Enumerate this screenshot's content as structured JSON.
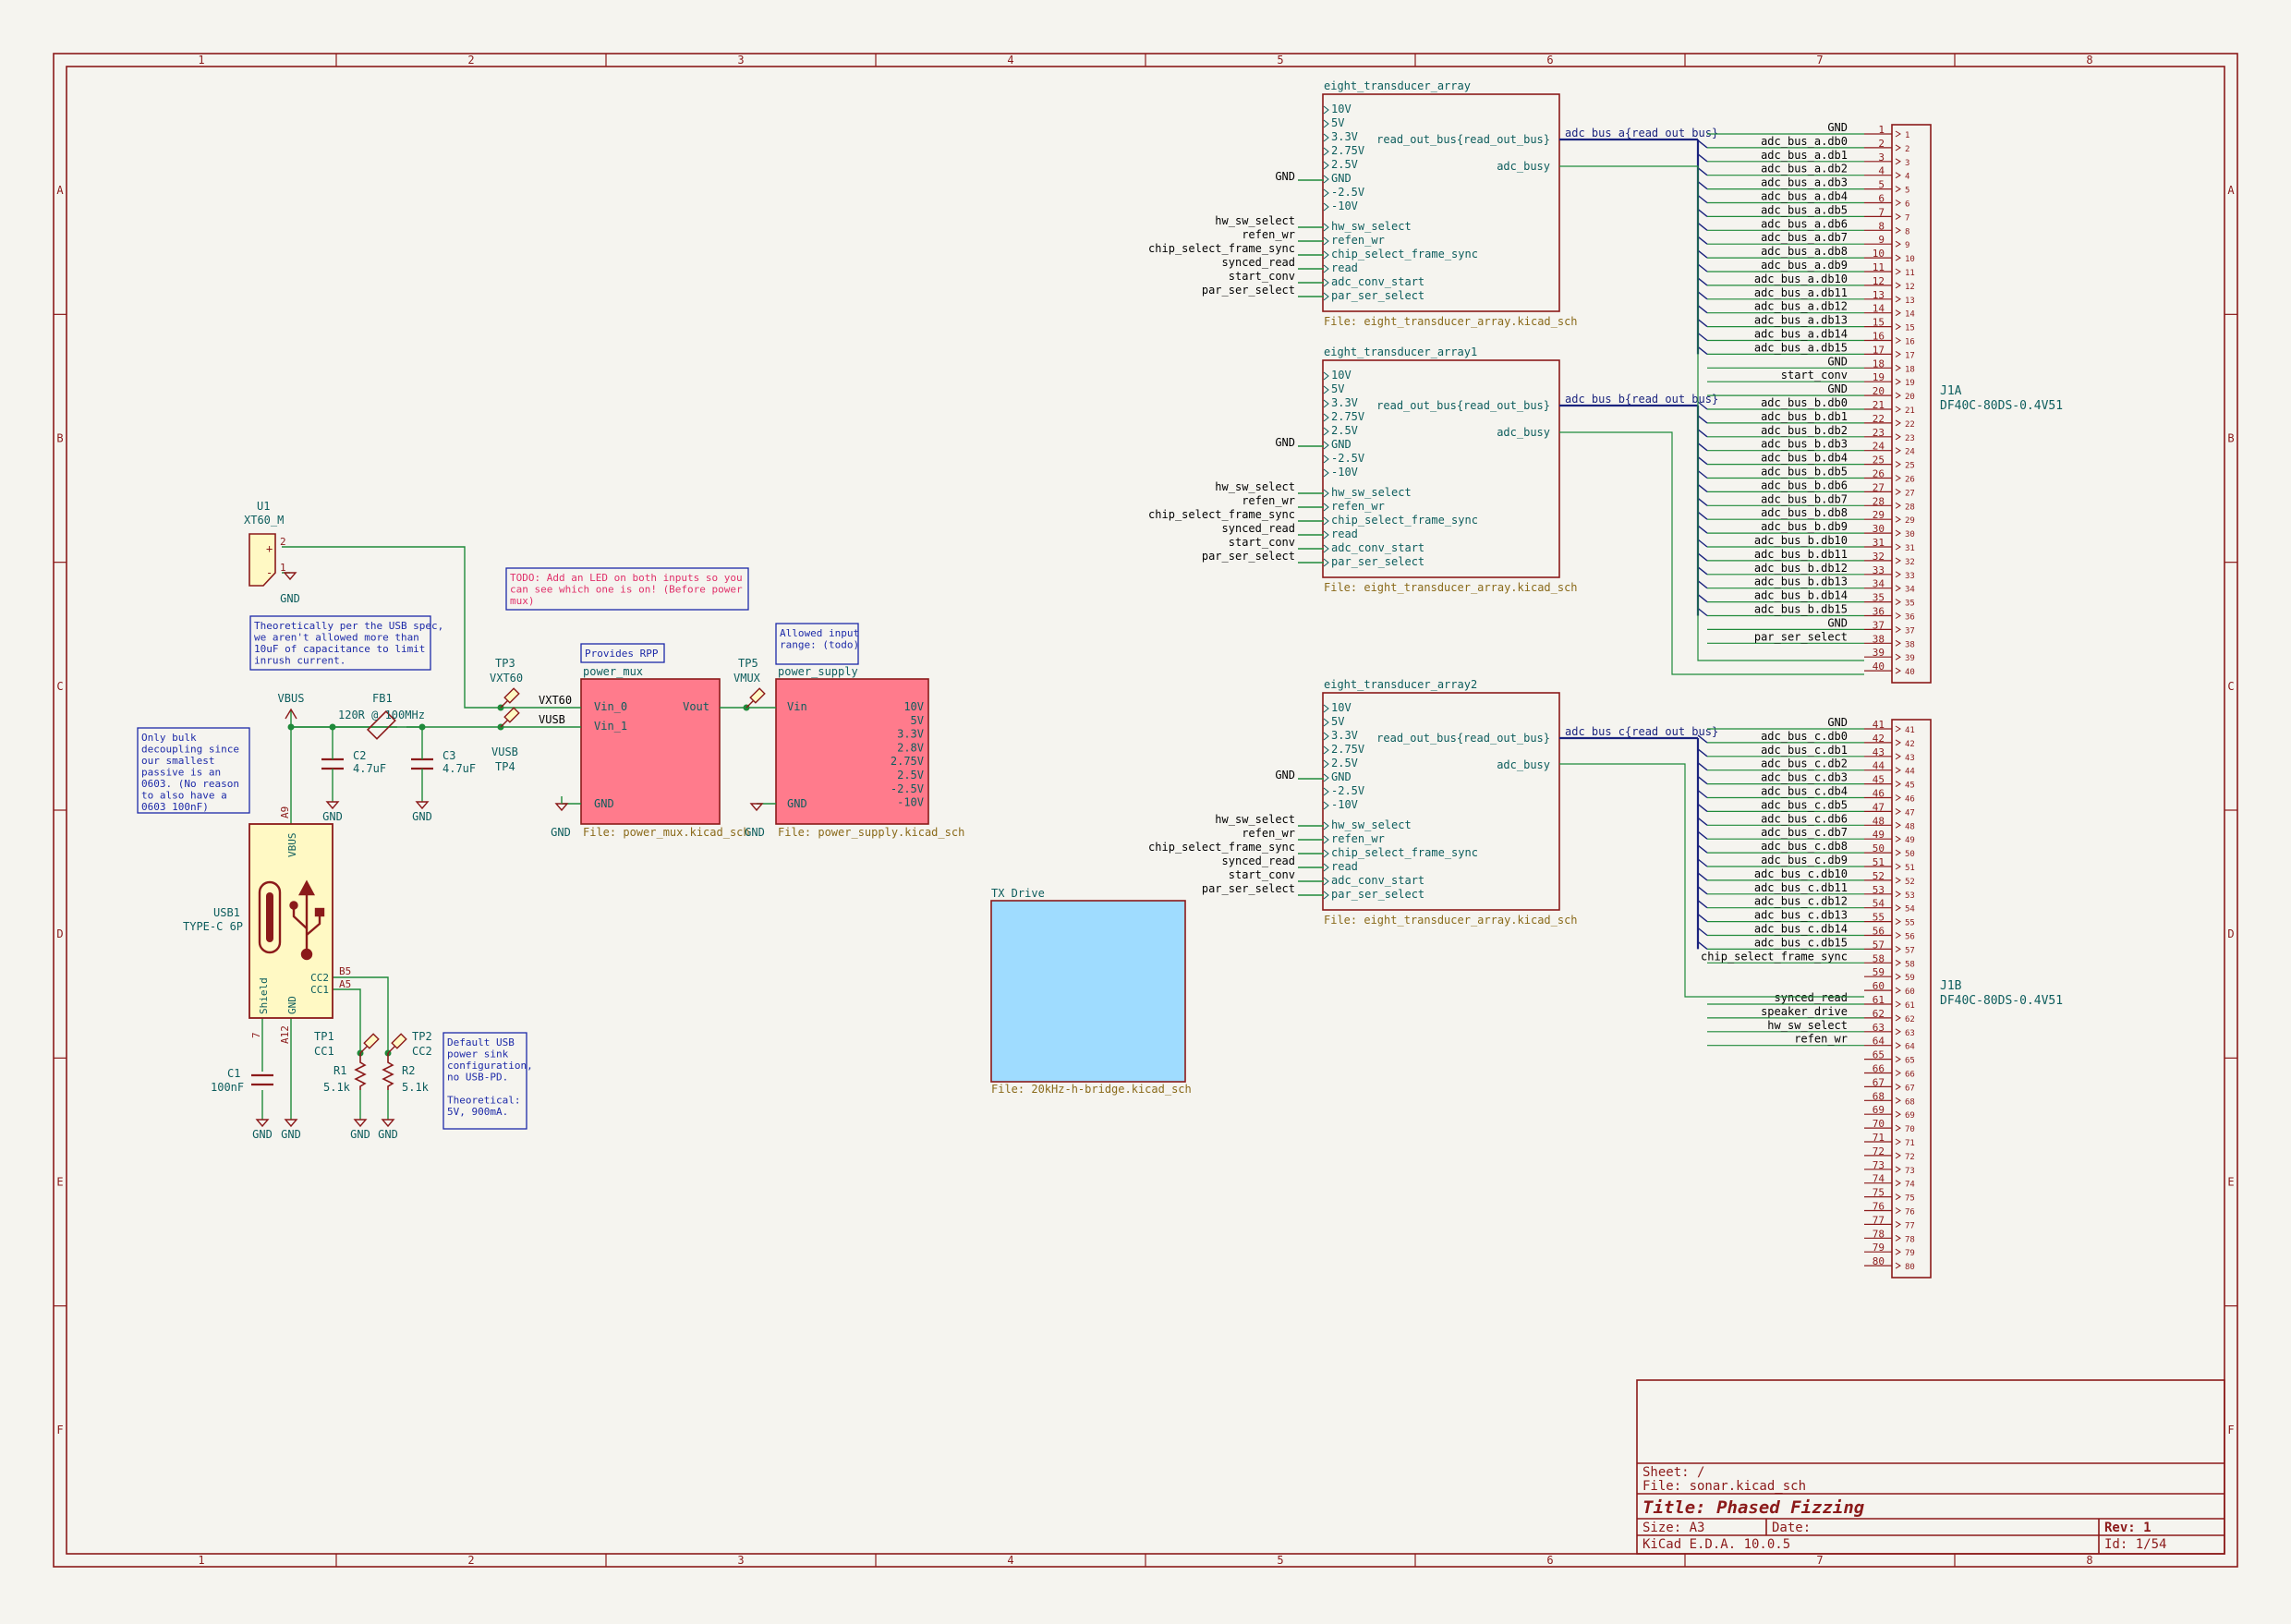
{
  "colors": {
    "frame": "#8b1a1a",
    "wire": "#1f8a3a",
    "bus": "#1a237e",
    "label": "#0d5d5d",
    "ref": "#0d5d5d",
    "note": "#1d2aa8",
    "todo": "#e0306a",
    "sheet_file": "#8a6a1a",
    "pink": "#ff7b8c",
    "blue": "#9fdcff",
    "comp_fill": "#fff9c4"
  },
  "frame": {
    "columns": [
      "1",
      "2",
      "3",
      "4",
      "5",
      "6",
      "7",
      "8"
    ],
    "rows": [
      "A",
      "B",
      "C",
      "D",
      "E",
      "F"
    ]
  },
  "title_block": {
    "sheet": "Sheet: /",
    "file": "File: sonar.kicad_sch",
    "title": "Title: Phased Fizzing",
    "size": "Size: A3",
    "date": "Date:",
    "rev": "Rev: 1",
    "tool": "KiCad E.D.A. 10.0.5",
    "id": "Id: 1/54"
  },
  "hier_labels": {
    "adc": [
      "hw_sw_select",
      "refen_wr",
      "chip_select_frame_sync",
      "synced_read",
      "start_conv",
      "par_ser_select"
    ],
    "gnd": "GND"
  },
  "sheets": {
    "eta": [
      {
        "name": "eight_transducer_array",
        "file": "File: eight_transducer_array.kicad_sch",
        "bus_label": "adc_bus_a{read_out_bus}"
      },
      {
        "name": "eight_transducer_array1",
        "file": "File: eight_transducer_array.kicad_sch",
        "bus_label": "adc_bus_b{read_out_bus}"
      },
      {
        "name": "eight_transducer_array2",
        "file": "File: eight_transducer_array.kicad_sch",
        "bus_label": "adc_bus_c{read_out_bus}"
      }
    ],
    "eta_pins_left": [
      "10V",
      "5V",
      "3.3V",
      "2.75V",
      "2.5V",
      "GND",
      "-2.5V",
      "-10V"
    ],
    "eta_pins_left2": [
      "hw_sw_select",
      "refen_wr",
      "chip_select_frame_sync",
      "read",
      "adc_conv_start",
      "par_ser_select"
    ],
    "eta_pins_right": [
      "read_out_bus{read_out_bus}",
      "adc_busy"
    ],
    "power_mux": {
      "name": "power_mux",
      "file": "File: power_mux.kicad_sch",
      "pins_left": [
        "Vin_0",
        "Vin_1",
        "GND"
      ],
      "pin_right": "Vout"
    },
    "power_supply": {
      "name": "power_supply",
      "file": "File: power_supply.kicad_sch",
      "pins_left": [
        "Vin",
        "GND"
      ],
      "pins_right": [
        "10V",
        "5V",
        "3.3V",
        "2.8V",
        "2.75V",
        "2.5V",
        "-2.5V",
        "-10V"
      ]
    },
    "tx_drive": {
      "name": "TX Drive",
      "file": "File: 20kHz-h-bridge.kicad_sch"
    }
  },
  "connector_a": {
    "ref": "J1A",
    "value": "DF40C-80DS-0.4V51",
    "pins": [
      "GND",
      "adc_bus_a.db0",
      "adc_bus_a.db1",
      "adc_bus_a.db2",
      "adc_bus_a.db3",
      "adc_bus_a.db4",
      "adc_bus_a.db5",
      "adc_bus_a.db6",
      "adc_bus_a.db7",
      "adc_bus_a.db8",
      "adc_bus_a.db9",
      "adc_bus_a.db10",
      "adc_bus_a.db11",
      "adc_bus_a.db12",
      "adc_bus_a.db13",
      "adc_bus_a.db14",
      "adc_bus_a.db15",
      "GND",
      "start_conv",
      "GND",
      "adc_bus_b.db0",
      "adc_bus_b.db1",
      "adc_bus_b.db2",
      "adc_bus_b.db3",
      "adc_bus_b.db4",
      "adc_bus_b.db5",
      "adc_bus_b.db6",
      "adc_bus_b.db7",
      "adc_bus_b.db8",
      "adc_bus_b.db9",
      "adc_bus_b.db10",
      "adc_bus_b.db11",
      "adc_bus_b.db12",
      "adc_bus_b.db13",
      "adc_bus_b.db14",
      "adc_bus_b.db15",
      "GND",
      "par_ser_select",
      "",
      ""
    ]
  },
  "connector_b": {
    "ref": "J1B",
    "value": "DF40C-80DS-0.4V51",
    "pins": [
      "GND",
      "adc_bus_c.db0",
      "adc_bus_c.db1",
      "adc_bus_c.db2",
      "adc_bus_c.db3",
      "adc_bus_c.db4",
      "adc_bus_c.db5",
      "adc_bus_c.db6",
      "adc_bus_c.db7",
      "adc_bus_c.db8",
      "adc_bus_c.db9",
      "adc_bus_c.db10",
      "adc_bus_c.db11",
      "adc_bus_c.db12",
      "adc_bus_c.db13",
      "adc_bus_c.db14",
      "adc_bus_c.db15",
      "chip_select_frame_sync",
      "",
      "",
      "synced_read",
      "speaker_drive",
      "hw_sw_select",
      "refen_wr",
      "",
      "",
      "",
      "",
      "",
      "",
      "",
      "",
      "",
      "",
      "",
      "",
      "",
      "",
      "",
      ""
    ]
  },
  "components": {
    "u1_ref": "U1",
    "u1_val": "XT60_M",
    "u1_pin1": "1",
    "u1_pin2": "2",
    "fb1_ref": "FB1",
    "fb1_val": "120R @ 100MHz",
    "c1_ref": "C1",
    "c1_val": "100nF",
    "c2_ref": "C2",
    "c2_val": "4.7uF",
    "c3_ref": "C3",
    "c3_val": "4.7uF",
    "r1_ref": "R1",
    "r1_val": "5.1k",
    "r2_ref": "R2",
    "r2_val": "5.1k",
    "usb1_ref": "USB1",
    "usb1_val": "TYPE-C 6P",
    "usb_vbus": "VBUS",
    "usb_shield": "Shield",
    "usb_gnd": "GND",
    "usb_cc2": "CC2",
    "usb_cc1": "CC1",
    "usb_a9": "A9",
    "usb_a12": "A12",
    "usb_b5": "B5",
    "usb_a5": "A5",
    "usb_7": "7",
    "tp1_ref": "TP1",
    "tp1_val": "CC1",
    "tp2_ref": "TP2",
    "tp2_val": "CC2",
    "tp3_ref": "TP3",
    "tp3_val": "VXT60",
    "tp4_ref": "TP4",
    "tp4_val": "VUSB",
    "tp5_ref": "TP5",
    "tp5_val": "VMUX",
    "vbus": "VBUS",
    "gnd": "GND",
    "net_vxt60": "VXT60",
    "net_vusb": "VUSB"
  },
  "notes": {
    "inrush": [
      "Theoretically per the USB spec,",
      "we aren't allowed more than",
      "10uF of capacitance to limit",
      "inrush current."
    ],
    "bulk": [
      "Only bulk",
      "decoupling since",
      "our smallest",
      "passive is an",
      "0603. (No reason",
      "to also have a",
      "0603 100nF)"
    ],
    "todo": [
      "TODO: Add an LED on both inputs so you",
      "can see which one is on! (Before power",
      "mux)"
    ],
    "rpp": [
      "Provides RPP"
    ],
    "range": [
      "Allowed input",
      "range: (todo)"
    ],
    "usb_default": [
      "Default USB",
      "power sink",
      "configuration,",
      "no USB-PD.",
      "",
      "Theoretical:",
      "5V, 900mA."
    ]
  }
}
